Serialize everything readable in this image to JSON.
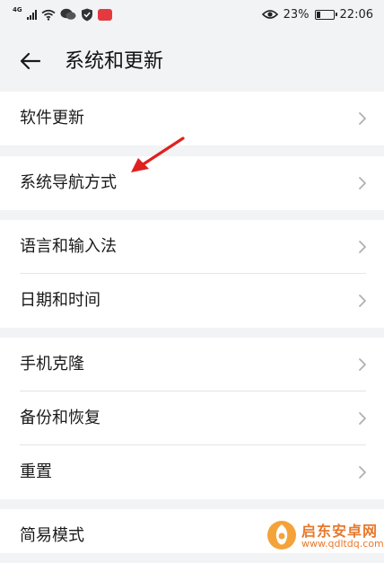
{
  "status_bar": {
    "network": "4G",
    "battery_percent": "23%",
    "battery_level": 0.23,
    "time": "22:06",
    "icons": [
      "signal-icon",
      "wifi-icon",
      "chat-icon",
      "shield-icon",
      "app-badge-icon",
      "eye-icon",
      "battery-icon"
    ]
  },
  "header": {
    "title": "系统和更新",
    "back_icon": "back-arrow-icon"
  },
  "groups": [
    {
      "items": [
        {
          "label": "软件更新"
        }
      ]
    },
    {
      "items": [
        {
          "label": "系统导航方式"
        }
      ]
    },
    {
      "items": [
        {
          "label": "语言和输入法"
        },
        {
          "label": "日期和时间"
        }
      ]
    },
    {
      "items": [
        {
          "label": "手机克隆"
        },
        {
          "label": "备份和恢复"
        },
        {
          "label": "重置"
        }
      ]
    },
    {
      "items": [
        {
          "label": "简易模式"
        }
      ]
    }
  ],
  "watermark": {
    "title": "启东安卓网",
    "url": "www.qdltdq.com"
  },
  "colors": {
    "background": "#f1f3f5",
    "card": "#ffffff",
    "annotation_arrow": "#e0201f",
    "watermark": "#e8782b"
  }
}
